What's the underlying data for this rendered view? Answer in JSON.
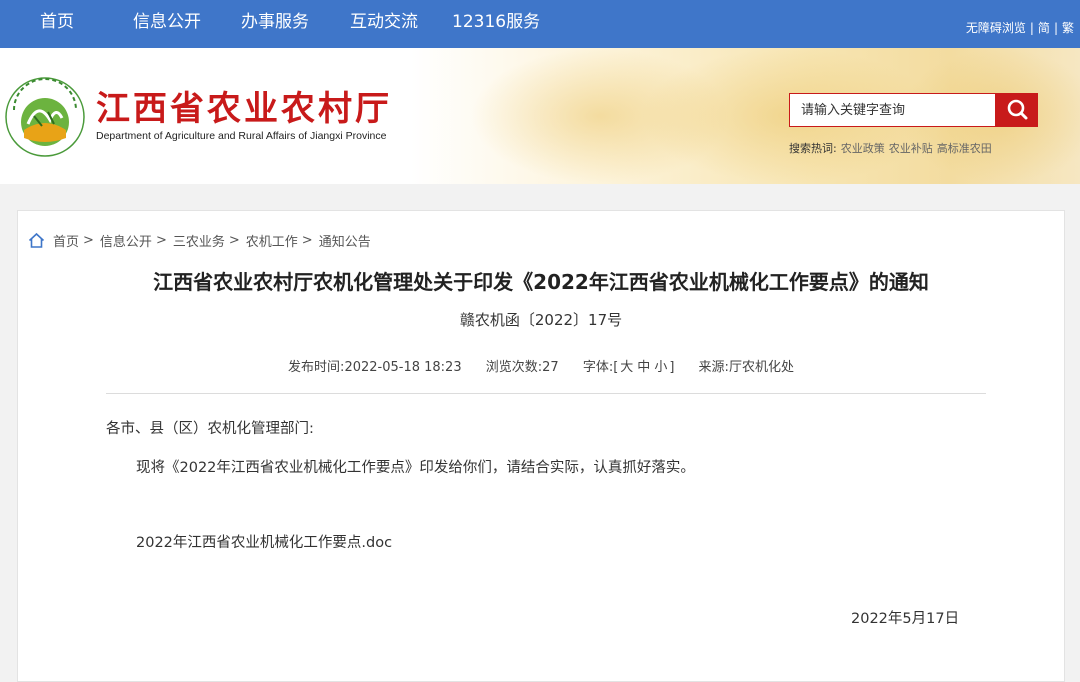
{
  "nav": {
    "items": [
      "首页",
      "信息公开",
      "办事服务",
      "互动交流",
      "12316服务"
    ],
    "accessibility": "无障碍浏览",
    "simplified": "简",
    "traditional": "繁"
  },
  "header": {
    "title": "江西省农业农村厅",
    "subtitle": "Department of Agriculture and Rural Affairs of Jiangxi Province",
    "search_placeholder": "请输入关键字查询",
    "hot_label": "搜索热词:",
    "hot_words": [
      "农业政策",
      "农业补贴",
      "高标准农田"
    ]
  },
  "breadcrumb": [
    "首页",
    "信息公开",
    "三农业务",
    "农机工作",
    "通知公告"
  ],
  "breadcrumb_sep": ">",
  "article": {
    "title": "江西省农业农村厅农机化管理处关于印发《2022年江西省农业机械化工作要点》的通知",
    "doc_number": "赣农机函〔2022〕17号",
    "publish_label": "发布时间:",
    "publish_time": "2022-05-18 18:23",
    "views_label": "浏览次数:",
    "views": "27",
    "font_label": "字体:",
    "font_sizes": [
      "大",
      "中",
      "小"
    ],
    "source_label": "来源:",
    "source": "厅农机化处",
    "salutation": "各市、县（区）农机化管理部门:",
    "body": "现将《2022年江西省农业机械化工作要点》印发给你们，请结合实际，认真抓好落实。",
    "attachment": "2022年江西省农业机械化工作要点.doc",
    "date": "2022年5月17日"
  },
  "colors": {
    "nav_bg": "#3f76c9",
    "brand_red": "#c81a1a",
    "page_bg": "#f2f2f2"
  }
}
